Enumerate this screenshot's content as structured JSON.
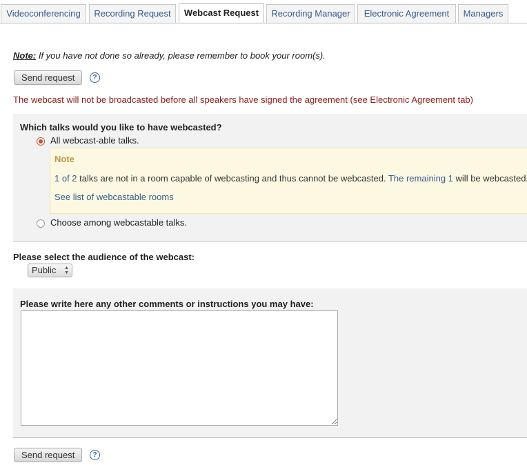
{
  "tabs": [
    {
      "label": "Videoconferencing"
    },
    {
      "label": "Recording Request"
    },
    {
      "label": "Webcast Request"
    },
    {
      "label": "Recording Manager"
    },
    {
      "label": "Electronic Agreement"
    },
    {
      "label": "Managers"
    }
  ],
  "note": {
    "label": "Note:",
    "text": " If you have not done so already, please remember to book your room(s)."
  },
  "send_button_label": "Send request",
  "help_glyph": "?",
  "warning_text": "The webcast will not be broadcasted before all speakers have signed the agreement (see Electronic Agreement tab)",
  "talks": {
    "question": "Which talks would you like to have webcasted?",
    "option_all": "All webcast-able talks.",
    "option_choose": "Choose among webcastable talks.",
    "selected": "all",
    "notebox": {
      "title": "Note",
      "count_link": "1 of 2",
      "middle_text": " talks are not in a room capable of webcasting and thus cannot be webcasted. ",
      "remaining_link": "The remaining 1",
      "tail_text": " will be webcasted.",
      "rooms_link": "See list of webcastable rooms"
    }
  },
  "audience": {
    "question": "Please select the audience of the webcast:",
    "selected": "Public"
  },
  "comments": {
    "question": "Please write here any other comments or instructions you may have:",
    "value": ""
  },
  "colors": {
    "link": "#345c8a",
    "warning": "#8b1a1a",
    "note_title": "#b89a4a",
    "radio_selected": "#d24b2a"
  }
}
